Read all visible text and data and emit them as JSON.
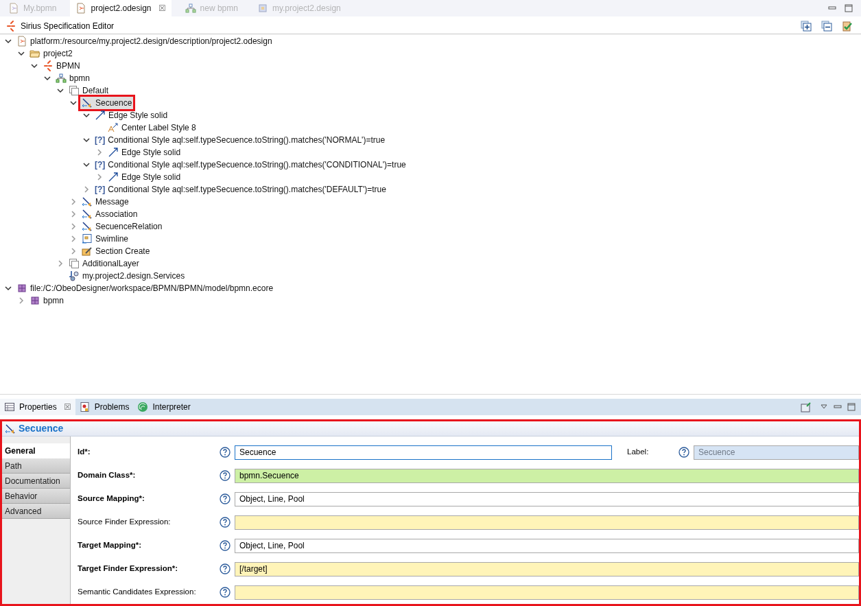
{
  "editor_tabs": [
    {
      "label": "My.bpmn",
      "kind": "diagram-file",
      "selected": false
    },
    {
      "label": "project2.odesign",
      "kind": "odesign-file",
      "selected": true,
      "close": "☒"
    },
    {
      "label": "new bpmn",
      "kind": "diagram",
      "selected": false
    },
    {
      "label": "my.project2.design",
      "kind": "plugin",
      "selected": false
    }
  ],
  "editor": {
    "title": "Sirius Specification Editor"
  },
  "tree": [
    {
      "label": "platform:/resource/my.project2.design/description/project2.odesign",
      "kind": "odesign-file",
      "expandable": true,
      "expanded": true,
      "selected": false,
      "children": [
        {
          "label": "project2",
          "kind": "folder",
          "expandable": true,
          "expanded": true,
          "selected": false,
          "children": [
            {
              "label": "BPMN",
              "kind": "sirius",
              "expandable": true,
              "expanded": true,
              "selected": false,
              "children": [
                {
                  "label": "bpmn",
                  "kind": "diagram",
                  "expandable": true,
                  "expanded": true,
                  "selected": false,
                  "children": [
                    {
                      "label": "Default",
                      "kind": "layer",
                      "expandable": true,
                      "expanded": true,
                      "selected": false,
                      "children": [
                        {
                          "label": "Secuence",
                          "kind": "edge-mapping",
                          "expandable": true,
                          "expanded": true,
                          "selected": true,
                          "children": [
                            {
                              "label": "Edge Style solid",
                              "kind": "edge-style",
                              "expandable": true,
                              "expanded": true,
                              "selected": false,
                              "children": [
                                {
                                  "label": "Center Label Style 8",
                                  "kind": "label-style",
                                  "expandable": false,
                                  "selected": false
                                }
                              ]
                            },
                            {
                              "label": "Conditional Style aql:self.typeSecuence.toString().matches('NORMAL')=true",
                              "kind": "conditional",
                              "marker": "[?]",
                              "expandable": true,
                              "expanded": true,
                              "selected": false,
                              "children": [
                                {
                                  "label": "Edge Style solid",
                                  "kind": "edge-style",
                                  "expandable": true,
                                  "expanded": false,
                                  "selected": false
                                }
                              ]
                            },
                            {
                              "label": "Conditional Style aql:self.typeSecuence.toString().matches('CONDITIONAL')=true",
                              "kind": "conditional",
                              "marker": "[?]",
                              "expandable": true,
                              "expanded": true,
                              "selected": false,
                              "children": [
                                {
                                  "label": "Edge Style solid",
                                  "kind": "edge-style",
                                  "expandable": true,
                                  "expanded": false,
                                  "selected": false
                                }
                              ]
                            },
                            {
                              "label": "Conditional Style aql:self.typeSecuence.toString().matches('DEFAULT')=true",
                              "kind": "conditional",
                              "marker": "[?]",
                              "expandable": true,
                              "expanded": false,
                              "selected": false
                            }
                          ]
                        },
                        {
                          "label": "Message",
                          "kind": "edge-mapping",
                          "expandable": true,
                          "expanded": false,
                          "selected": false
                        },
                        {
                          "label": "Association",
                          "kind": "edge-mapping",
                          "expandable": true,
                          "expanded": false,
                          "selected": false
                        },
                        {
                          "label": "SecuenceRelation",
                          "kind": "edge-mapping",
                          "expandable": true,
                          "expanded": false,
                          "selected": false
                        },
                        {
                          "label": "Swimline",
                          "kind": "container",
                          "expandable": true,
                          "expanded": false,
                          "selected": false
                        },
                        {
                          "label": "Section Create",
                          "kind": "tool",
                          "expandable": true,
                          "expanded": false,
                          "selected": false
                        }
                      ]
                    },
                    {
                      "label": "AdditionalLayer",
                      "kind": "layer",
                      "expandable": true,
                      "expanded": false,
                      "selected": false
                    },
                    {
                      "label": "my.project2.design.Services",
                      "kind": "java",
                      "expandable": false,
                      "selected": false
                    }
                  ]
                }
              ]
            }
          ]
        }
      ]
    },
    {
      "label": "file:/C:/ObeoDesigner/workspace/BPMN/BPMN/model/bpmn.ecore",
      "kind": "package",
      "expandable": true,
      "expanded": true,
      "selected": false,
      "children": [
        {
          "label": "bpmn",
          "kind": "package",
          "expandable": true,
          "expanded": false,
          "selected": false
        }
      ]
    }
  ],
  "bottom_tabs": [
    {
      "label": "Properties",
      "kind": "table",
      "selected": true,
      "close": "☒"
    },
    {
      "label": "Problems",
      "kind": "problems",
      "selected": false
    },
    {
      "label": "Interpreter",
      "kind": "interpreter",
      "selected": false
    }
  ],
  "properties": {
    "title": "Secuence",
    "sections": [
      {
        "label": "General",
        "selected": true
      },
      {
        "label": "Path",
        "selected": false
      },
      {
        "label": "Documentation",
        "selected": false
      },
      {
        "label": "Behavior",
        "selected": false
      },
      {
        "label": "Advanced",
        "selected": false
      }
    ],
    "rows": [
      {
        "label": "Id*:",
        "required": true,
        "kind": "plain",
        "value": "Secuence",
        "focused": true,
        "extra": {
          "label": "Label:",
          "placeholder": "Secuence",
          "disabled": true
        }
      },
      {
        "label": "Domain Class*:",
        "required": true,
        "kind": "domain",
        "value": "bpmn.Secuence",
        "focused": false
      },
      {
        "label": "Source Mapping*:",
        "required": true,
        "kind": "plain",
        "value": "Object, Line, Pool",
        "focused": false
      },
      {
        "label": "Source Finder Expression:",
        "required": false,
        "kind": "expression",
        "focused": false
      },
      {
        "label": "Target Mapping*:",
        "required": true,
        "kind": "plain",
        "value": "Object, Line, Pool",
        "focused": false
      },
      {
        "label": "Target Finder Expression*:",
        "required": true,
        "kind": "expression",
        "value": "[/target]",
        "focused": false
      },
      {
        "label": "Semantic Candidates Expression:",
        "required": false,
        "kind": "expression",
        "focused": false
      }
    ]
  }
}
